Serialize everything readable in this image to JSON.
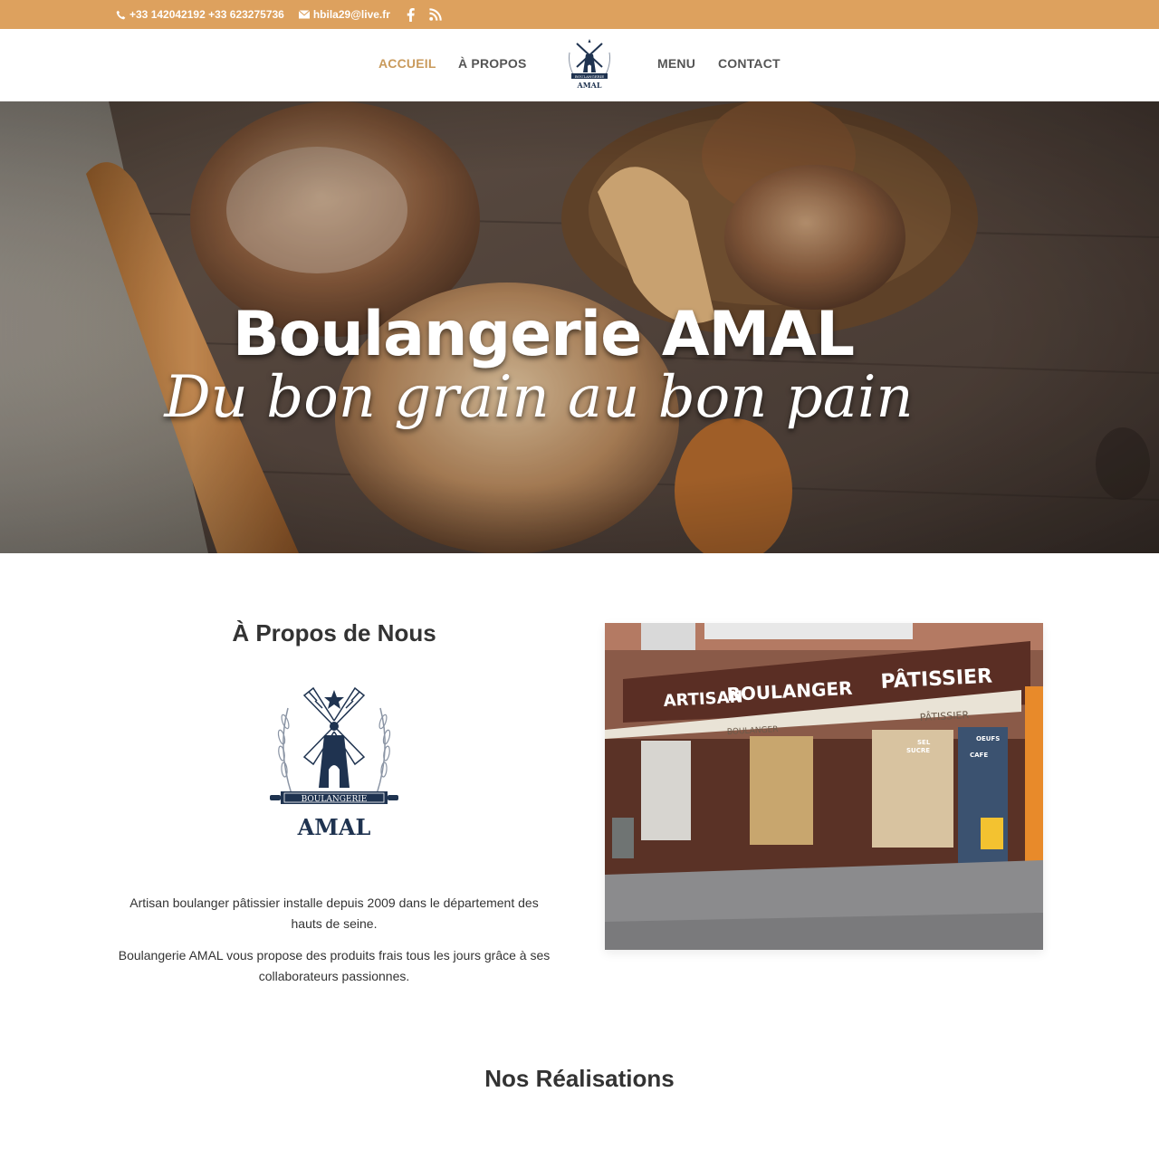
{
  "topbar": {
    "phone": "+33 142042192 +33 623275736",
    "email": "hbila29@live.fr",
    "icons": [
      "phone-icon",
      "mail-icon",
      "facebook-icon",
      "rss-icon"
    ],
    "background": "#dda15e"
  },
  "nav": {
    "items": [
      {
        "label": "ACCUEIL",
        "active": true
      },
      {
        "label": "À PROPOS",
        "active": false
      },
      {
        "label": "MENU",
        "active": false
      },
      {
        "label": "CONTACT",
        "active": false
      }
    ],
    "logo": {
      "top_text": "BOULANGERIE",
      "name": "AMAL"
    },
    "active_color": "#c99a5b"
  },
  "hero": {
    "title": "Boulangerie AMAL",
    "subtitle": "Du bon grain au bon pain"
  },
  "about": {
    "title": "À Propos de Nous",
    "logo": {
      "banner_text": "BOULANGERIE",
      "name": "AMAL"
    },
    "paragraphs": [
      "Artisan boulanger pâtissier installe depuis 2009 dans le département des hauts de seine.",
      "Boulangerie AMAL vous propose des produits frais tous les jours grâce à ses collaborateurs passionnes."
    ],
    "storefront": {
      "sign_words": [
        "ARTISAN",
        "BOULANGER",
        "PÂTISSIER"
      ],
      "awning_left": "BOULANGER",
      "awning_right": "PÂTISSIER",
      "window_words": [
        "SEL",
        "OEUFS",
        "SUCRE",
        "CAFE"
      ]
    }
  },
  "realisations": {
    "title": "Nos Réalisations"
  }
}
